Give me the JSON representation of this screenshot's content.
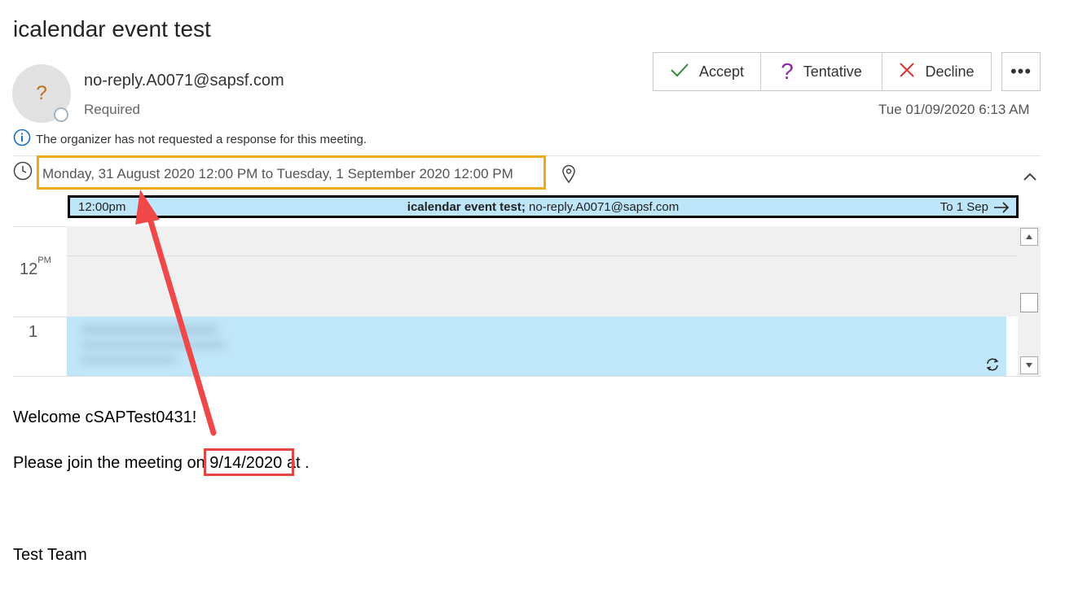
{
  "subject": "icalendar event test",
  "sender": {
    "avatar_initial": "?",
    "email": "no-reply.A0071@sapsf.com",
    "attendance": "Required"
  },
  "actions": {
    "accept": "Accept",
    "tentative": "Tentative",
    "decline": "Decline",
    "more": "•••"
  },
  "received_date": "Tue 01/09/2020 6:13 AM",
  "info_message": "The organizer has not requested a response for this meeting.",
  "meeting_time": "Monday, 31 August 2020 12:00 PM to Tuesday, 1 September 2020 12:00 PM",
  "event_bar": {
    "start": "12:00pm",
    "title": "icalendar event test;",
    "organizer": " no-reply.A0071@sapsf.com",
    "to": "To 1 Sep"
  },
  "calendar": {
    "hour_12": "12",
    "hour_12_suffix": "PM",
    "hour_1": "1"
  },
  "body": {
    "greeting": "Welcome cSAPTest0431!",
    "join_prefix": "Please join the meeting on ",
    "join_date": "9/14/2020",
    "join_suffix": " at .",
    "signature": "Test Team"
  },
  "colors": {
    "accept": "#2e8b3a",
    "tentative": "#8a2a9e",
    "decline": "#d93232",
    "info": "#1a6fc2",
    "annotation_box": "#f0a81e",
    "annotation_date_box": "#e54545",
    "arrow": "#f04848",
    "event_bg": "#bde6fa"
  }
}
